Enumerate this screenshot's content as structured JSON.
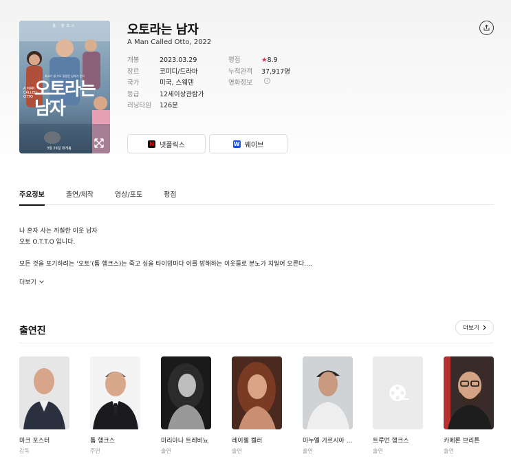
{
  "movie": {
    "title": "오토라는 남자",
    "subtitle": "A Man Called Otto, 2022",
    "poster": {
      "top_credit": "톰 행크스",
      "tagline": "최고가 될 수도 있었던 남자가 온다",
      "title": "오토라는 남자",
      "english": "A MAN CALLED OTTO",
      "release": "3월 29일 대개봉"
    }
  },
  "info_left": [
    {
      "key": "개봉",
      "value": "2023.03.29"
    },
    {
      "key": "장르",
      "value": "코미디/드라마"
    },
    {
      "key": "국가",
      "value": "미국, 스웨덴"
    },
    {
      "key": "등급",
      "value": "12세이상관람가"
    },
    {
      "key": "러닝타임",
      "value": "126분"
    }
  ],
  "info_right": [
    {
      "key": "평점",
      "star": "★",
      "value": "8.9"
    },
    {
      "key": "누적관객",
      "value": "37,917명"
    },
    {
      "key": "영화정보",
      "icon": "i"
    }
  ],
  "ott": [
    {
      "label": "넷플릭스",
      "logo": "N",
      "icon": "netflix-icon"
    },
    {
      "label": "웨이브",
      "logo": "W",
      "icon": "wavve-icon"
    }
  ],
  "tabs": [
    {
      "label": "주요정보",
      "active": true
    },
    {
      "label": "출연/제작",
      "active": false
    },
    {
      "label": "영상/포토",
      "active": false
    },
    {
      "label": "평점",
      "active": false
    }
  ],
  "synopsis": {
    "lines": [
      "나 혼자 사는 까칠한 이웃 남자",
      "오토 O.T.T.O 입니다.",
      "",
      "모든 것을 포기하려는 ‘오토’(톰 행크스)는 죽고 싶을 타이밍마다 이를 방해하는 이웃들로 분노가 치밀어 오른다...."
    ],
    "more_label": "더보기"
  },
  "cast": {
    "title": "출연진",
    "more_label": "더보기",
    "people": [
      {
        "name": "마크 포스터",
        "role": "감독"
      },
      {
        "name": "톰 행크스",
        "role": "주연"
      },
      {
        "name": "마리아나 트레비뇨",
        "role": "출연"
      },
      {
        "name": "레이첼 켈러",
        "role": "출연"
      },
      {
        "name": "마누엘 가르시아 ...",
        "role": "출연"
      },
      {
        "name": "트루먼 행크스",
        "role": "출연"
      },
      {
        "name": "카메론 브리튼",
        "role": "출연"
      }
    ]
  },
  "colors": {
    "accent_star": "#e8273e",
    "netflix": "#e50914",
    "wavve": "#1a52f0"
  }
}
